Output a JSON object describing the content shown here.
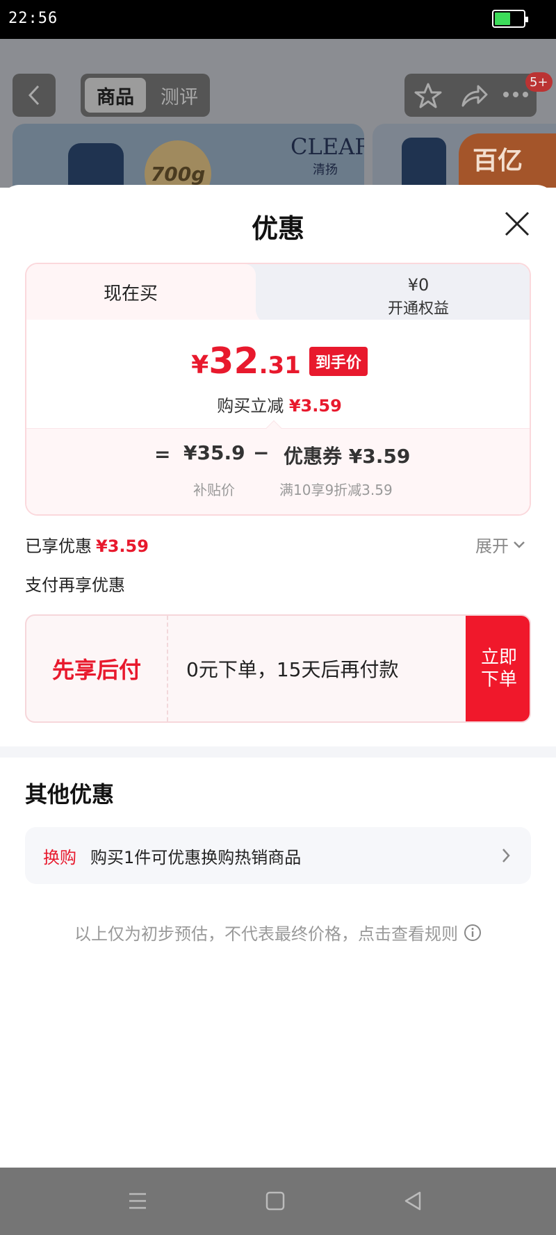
{
  "status_bar": {
    "time": "22:56"
  },
  "background": {
    "tab_active": "商品",
    "tab_inactive": "测评",
    "badge": "5+",
    "brand": "CLEAR",
    "brand_sub": "清扬",
    "medal": "700g",
    "promo_tag": "百亿"
  },
  "sheet": {
    "title": "优惠",
    "tabs": {
      "now_label": "现在买",
      "benefit_price": "¥0",
      "benefit_label": "开通权益"
    },
    "price": {
      "currency": "¥",
      "integer": "32",
      "decimal": ".31",
      "tag": "到手价",
      "reduce_label": "购买立减",
      "reduce_amount": "¥3.59"
    },
    "breakdown": {
      "equals": "=",
      "original": "¥35.9",
      "minus": "−",
      "coupon": "优惠券 ¥3.59",
      "original_label": "补贴价",
      "coupon_label": "满10享9折减3.59"
    },
    "enjoyed_label": "已享优惠",
    "enjoyed_amount": "¥3.59",
    "expand_label": "展开",
    "pay_more_label": "支付再享优惠",
    "bnpl": {
      "title": "先享后付",
      "desc": "0元下单，15天后再付款",
      "button": "立即下单"
    },
    "other_title": "其他优惠",
    "exchange": {
      "tag": "换购",
      "text": "购买1件可优惠换购热销商品"
    },
    "disclaimer": "以上仅为初步预估，不代表最终价格，点击查看规则"
  },
  "colors": {
    "accent": "#e8192d",
    "bnpl_button": "#f0182b"
  },
  "icons": [
    "back-icon",
    "star-icon",
    "share-icon",
    "more-icon",
    "close-icon",
    "chevron-down-icon",
    "chevron-right-icon",
    "info-icon",
    "menu-icon",
    "home-icon",
    "back-triangle-icon"
  ]
}
